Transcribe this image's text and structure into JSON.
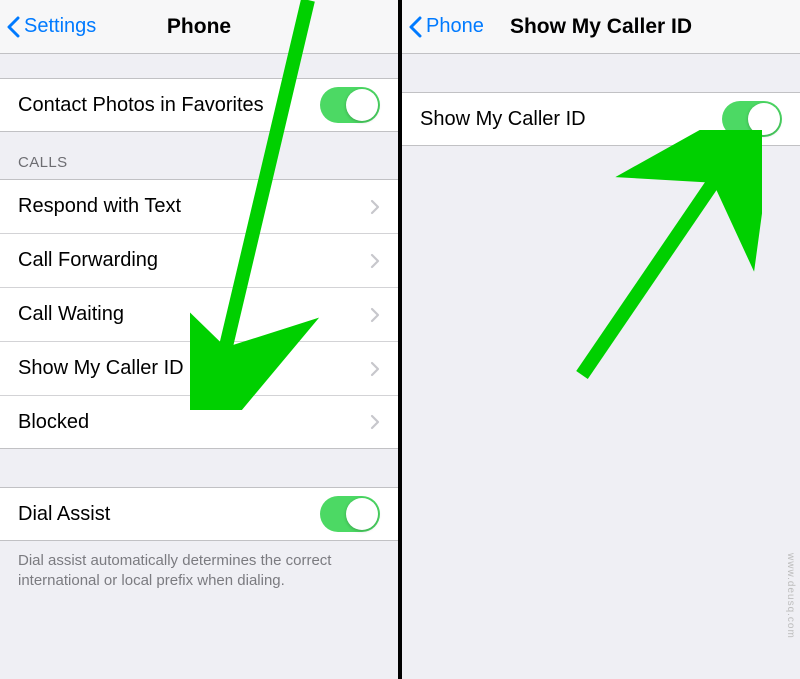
{
  "left": {
    "nav": {
      "back_label": "Settings",
      "title": "Phone"
    },
    "favorites_row": {
      "label": "Contact Photos in Favorites",
      "toggle_on": true
    },
    "calls_header": "CALLS",
    "calls_rows": [
      {
        "label": "Respond with Text"
      },
      {
        "label": "Call Forwarding"
      },
      {
        "label": "Call Waiting"
      },
      {
        "label": "Show My Caller ID"
      },
      {
        "label": "Blocked"
      }
    ],
    "dial_assist_row": {
      "label": "Dial Assist",
      "toggle_on": true
    },
    "dial_assist_footer": "Dial assist automatically determines the correct international or local prefix when dialing."
  },
  "right": {
    "nav": {
      "back_label": "Phone",
      "title": "Show My Caller ID"
    },
    "row": {
      "label": "Show My Caller ID",
      "toggle_on": true
    }
  },
  "watermark": "www.deusq.com",
  "colors": {
    "accent": "#007aff",
    "toggle_on": "#4cd964",
    "arrow": "#00d000"
  }
}
